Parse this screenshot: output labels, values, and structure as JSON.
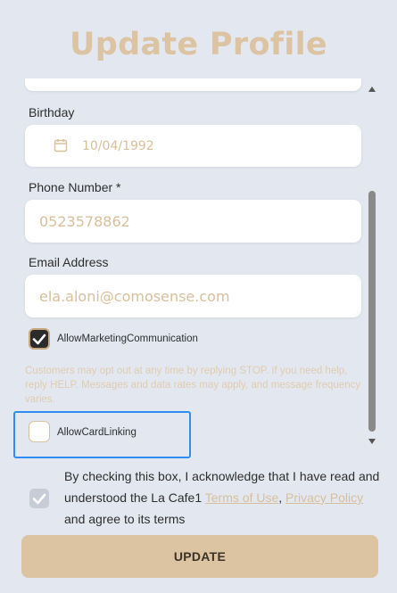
{
  "header": {
    "title": "Update Profile"
  },
  "form": {
    "birthday": {
      "label": "Birthday",
      "value": "10/04/1992"
    },
    "phone": {
      "label": "Phone Number *",
      "value": "0523578862"
    },
    "email": {
      "label": "Email Address",
      "value": "ela.aloni@comosense.com"
    },
    "marketing": {
      "label": "AllowMarketingCommunication",
      "checked": true
    },
    "marketing_note": "Customers may opt out at any time by replying STOP. If you need help, reply HELP. Messages and data rates may apply, and message frequency varies.",
    "card_linking": {
      "label": "AllowCardLinking",
      "checked": false
    }
  },
  "acknowledge": {
    "checked": true,
    "text_prefix": "By checking this box, I acknowledge that I have read and understood the La Cafe1 ",
    "terms_link": "Terms of Use",
    "separator": ", ",
    "privacy_link": "Privacy Policy",
    "text_suffix": " and agree to its terms"
  },
  "actions": {
    "update_label": "UPDATE"
  },
  "colors": {
    "accent": "#dcc3a1",
    "focus": "#2f8cf0",
    "background": "#e3e8f0"
  }
}
